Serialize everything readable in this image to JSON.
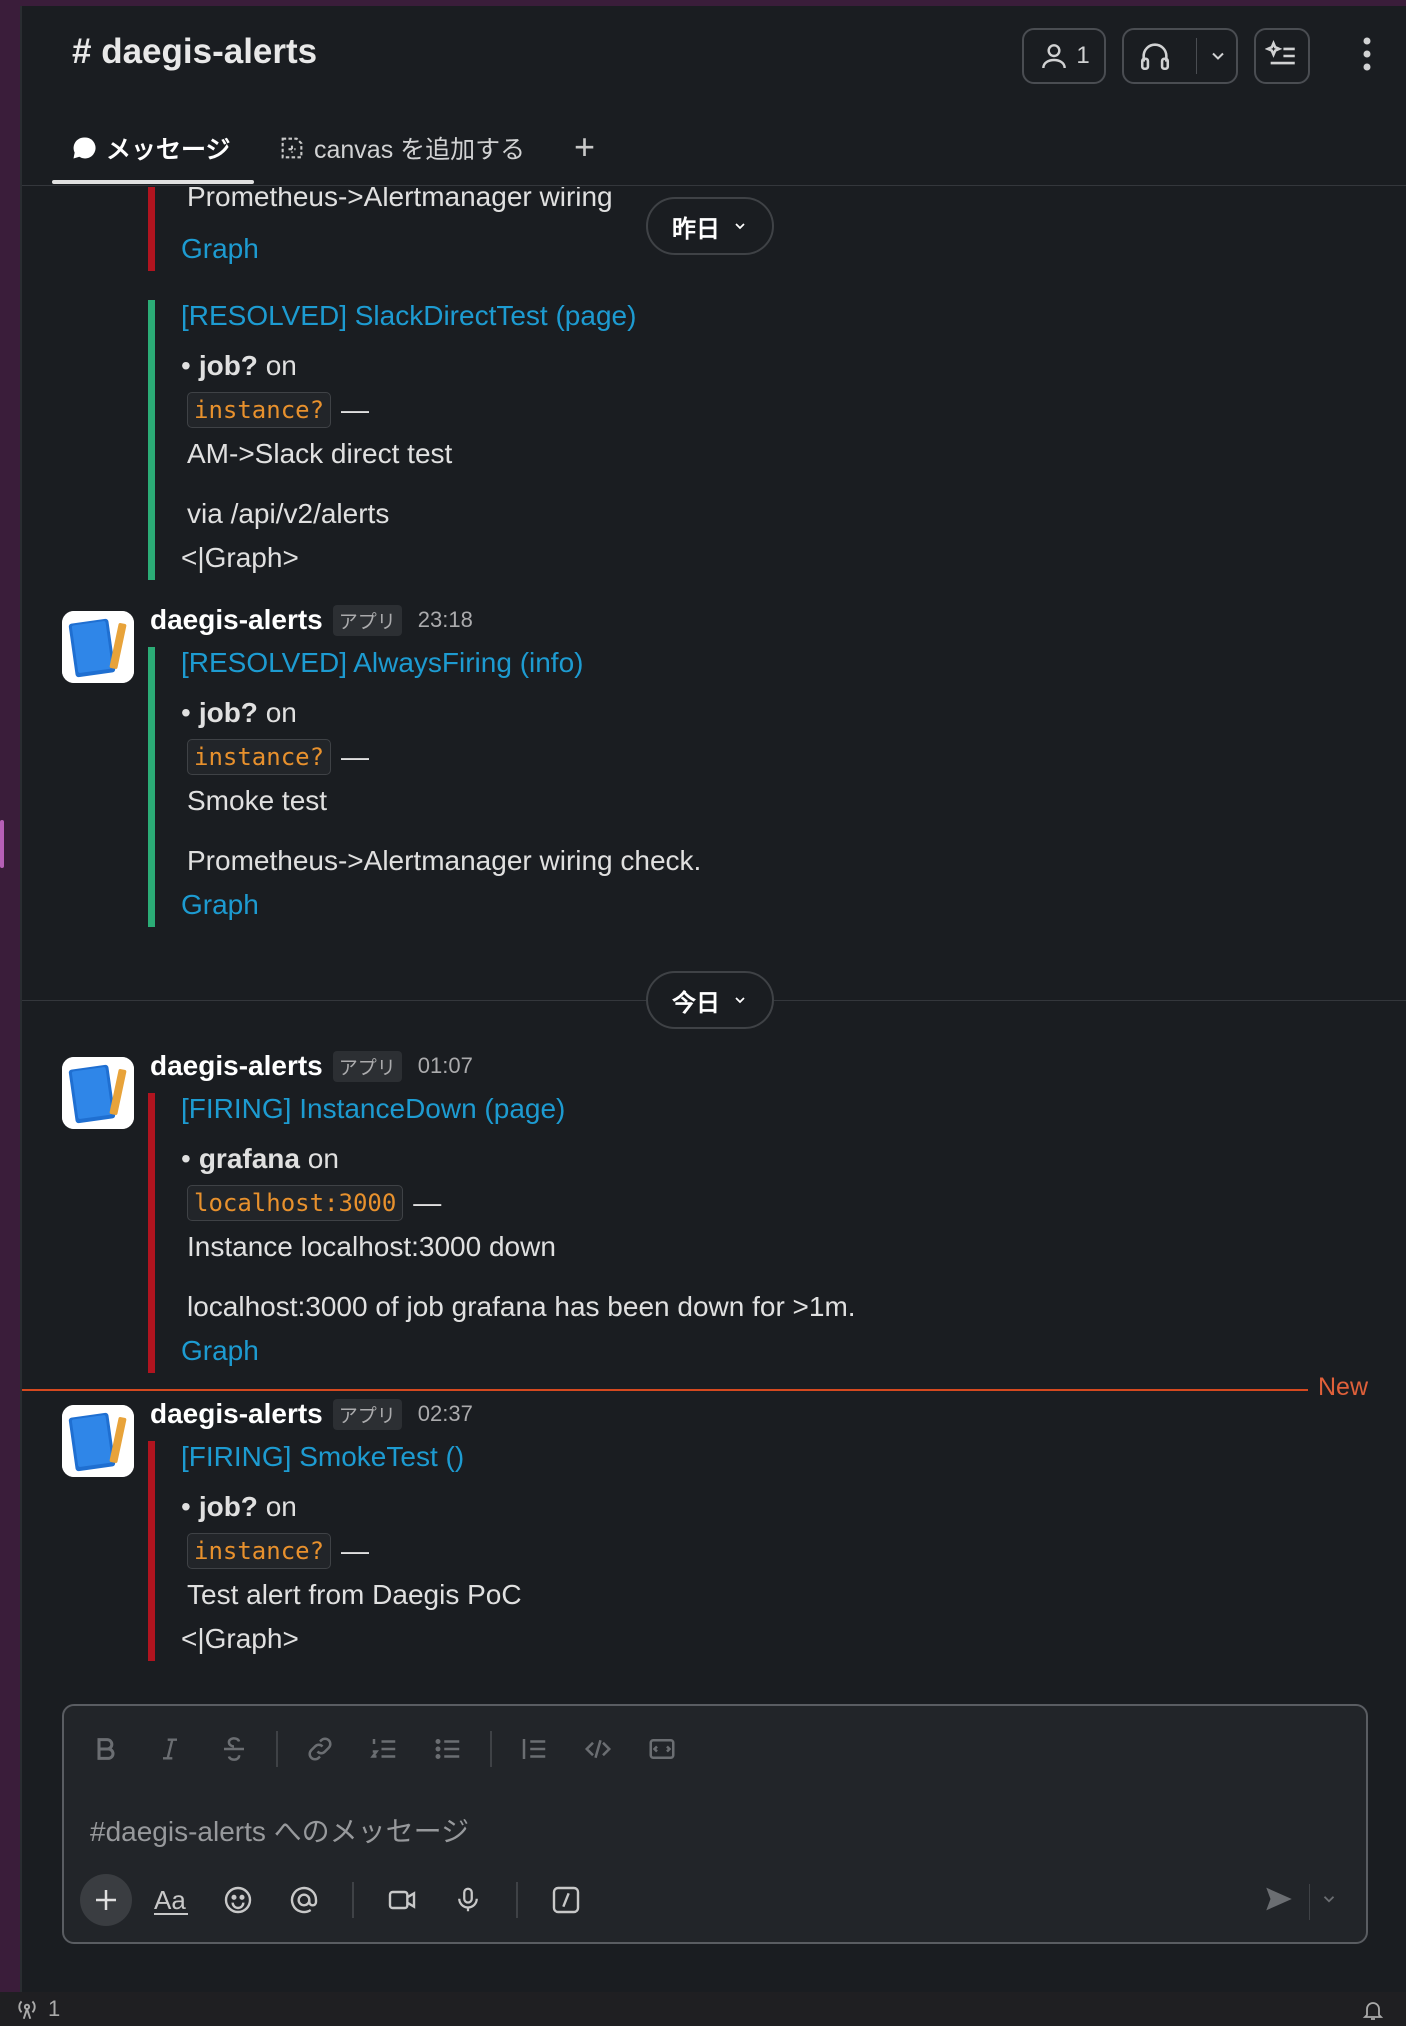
{
  "channel": {
    "title": "# daegis-alerts",
    "member_count": "1"
  },
  "tabs": {
    "messages": "メッセージ",
    "canvas": "canvas を追加する",
    "add": "+"
  },
  "dividers": {
    "yesterday": "昨日",
    "today": "今日",
    "new": "New"
  },
  "top_fragment": {
    "text": "Prometheus->Alertmanager wiring",
    "link": "Graph"
  },
  "attachment_1": {
    "title": "[RESOLVED] SlackDirectTest (page)",
    "job": "job?",
    "on": "on",
    "instance": "instance?",
    "dash": "—",
    "summary": "AM->Slack direct test",
    "description": "via /api/v2/alerts",
    "footer": "<|Graph>"
  },
  "message_1": {
    "sender": "daegis-alerts",
    "badge": "アプリ",
    "time": "23:18",
    "title": "[RESOLVED] AlwaysFiring (info)",
    "job": "job?",
    "on": "on",
    "instance": "instance?",
    "dash": "—",
    "summary": "Smoke test",
    "description": "Prometheus->Alertmanager wiring check.",
    "link": "Graph"
  },
  "message_2": {
    "sender": "daegis-alerts",
    "badge": "アプリ",
    "time": "01:07",
    "title": "[FIRING] InstanceDown (page)",
    "job": "grafana",
    "on": "on",
    "instance": "localhost:3000",
    "dash": "—",
    "summary": "Instance localhost:3000 down",
    "description": "localhost:3000 of job grafana has been down for >1m.",
    "link": "Graph"
  },
  "message_3": {
    "sender": "daegis-alerts",
    "badge": "アプリ",
    "time": "02:37",
    "title": "[FIRING] SmokeTest ()",
    "job": "job?",
    "on": "on",
    "instance": "instance?",
    "dash": "—",
    "summary": "Test alert from Daegis PoC",
    "footer": "<|Graph>"
  },
  "composer": {
    "placeholder": "#daegis-alerts へのメッセージ"
  },
  "status_bar": {
    "count": "1"
  },
  "colors": {
    "firing": "#b0141f",
    "resolved": "#2bac76",
    "link": "#1d9bd1",
    "code": "#e8912d",
    "new": "#d5491f"
  }
}
